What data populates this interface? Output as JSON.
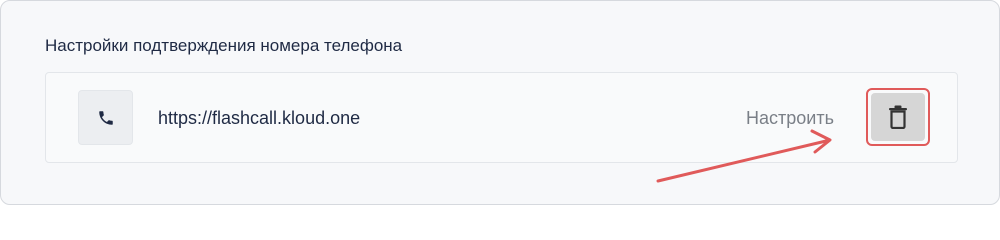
{
  "section": {
    "title": "Настройки подтверждения номера телефона"
  },
  "item": {
    "url": "https://flashcall.kloud.one",
    "configure_label": "Настроить",
    "icon": "phone-icon",
    "delete_icon": "trash-icon"
  },
  "annotation": {
    "highlight_color": "#e05a5a"
  }
}
